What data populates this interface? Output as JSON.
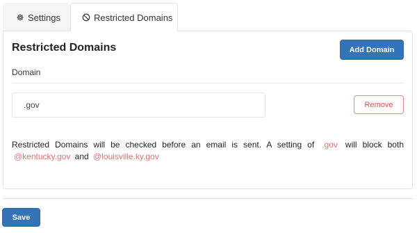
{
  "tabs": [
    {
      "label": "Settings",
      "icon": "gear-icon",
      "active": false
    },
    {
      "label": "Restricted Domains",
      "icon": "ban-icon",
      "active": true
    }
  ],
  "panel": {
    "title": "Restricted Domains",
    "add_button_label": "Add Domain",
    "domain_label": "Domain",
    "domains": [
      {
        "value": ".gov",
        "remove_label": "Remove"
      }
    ],
    "help": {
      "part1": "Restricted Domains will be checked before an email is sent. A setting of",
      "example_setting": ".gov",
      "part2": "will block both",
      "example_email1": "@kentucky.gov",
      "and": "and",
      "example_email2": "@louisville.ky.gov"
    }
  },
  "footer": {
    "save_label": "Save"
  },
  "colors": {
    "primary": "#3373b8",
    "danger": "#d9534f",
    "code_highlight": "#e8706c"
  }
}
